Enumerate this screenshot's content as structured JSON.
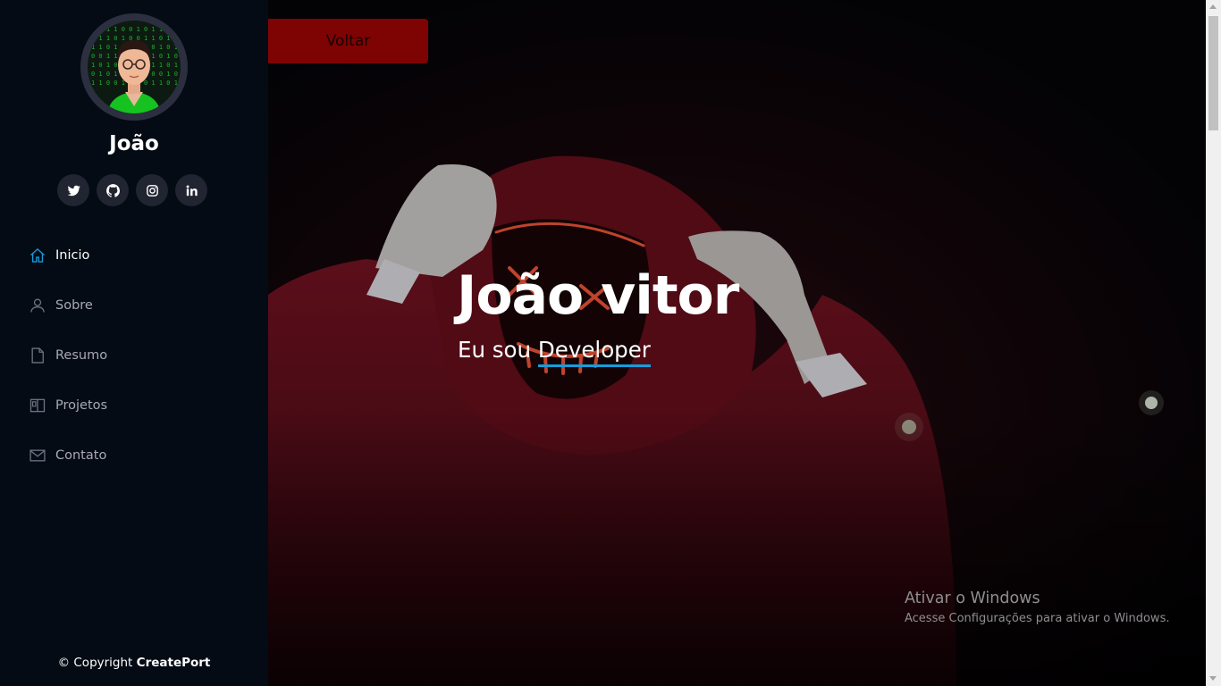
{
  "profile": {
    "name": "João",
    "avatar_icon": "developer-avatar-icon"
  },
  "social": [
    {
      "icon": "twitter-icon"
    },
    {
      "icon": "github-icon"
    },
    {
      "icon": "instagram-icon"
    },
    {
      "icon": "linkedin-icon"
    }
  ],
  "nav": {
    "items": [
      {
        "label": "Inicio",
        "icon": "home-icon",
        "active": true
      },
      {
        "label": "Sobre",
        "icon": "person-icon",
        "active": false
      },
      {
        "label": "Resumo",
        "icon": "file-icon",
        "active": false
      },
      {
        "label": "Projetos",
        "icon": "layout-icon",
        "active": false
      },
      {
        "label": "Contato",
        "icon": "envelope-icon",
        "active": false
      }
    ]
  },
  "footer": {
    "copyright_prefix": "© Copyright",
    "brand": "CreatePort"
  },
  "hero": {
    "back_label": "Voltar",
    "title": "João vitor",
    "subtitle_prefix": "Eu sou",
    "subtitle_typed": "Developer",
    "background": "hooded-figure-neon-mask-photo"
  },
  "windows_notice": {
    "title": "Ativar o Windows",
    "subtitle": "Acesse Configurações para ativar o Windows."
  },
  "colors": {
    "sidebar_bg": "#040b14",
    "accent": "#149ddd",
    "back_button": "#7e0303",
    "social_bg": "#212431",
    "nav_text": "#a8a9b4"
  }
}
